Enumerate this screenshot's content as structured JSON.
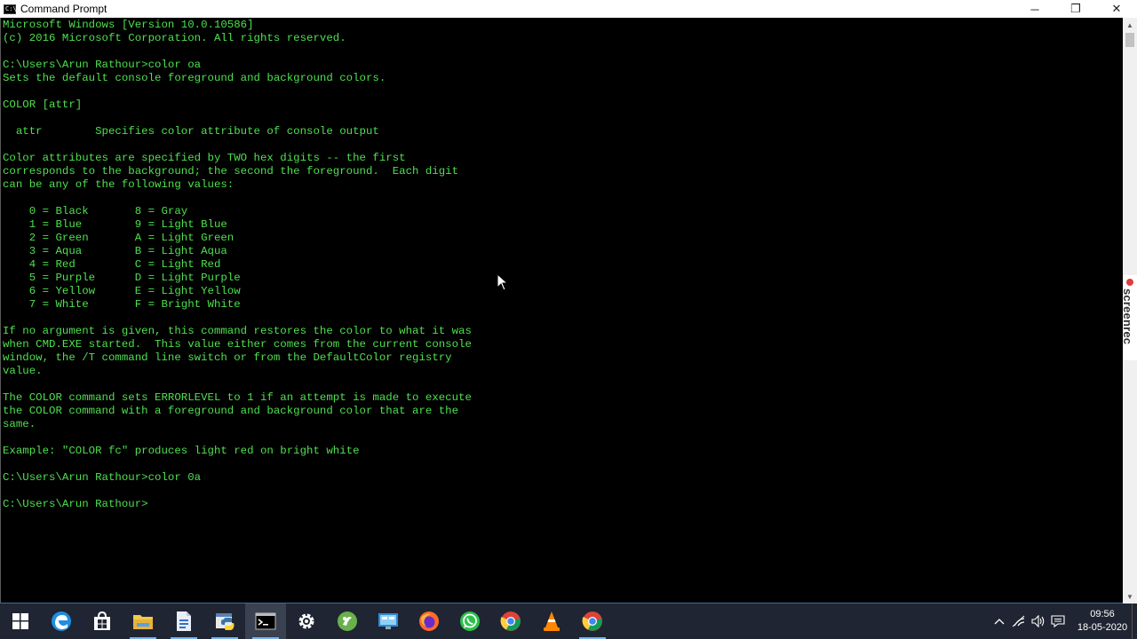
{
  "window": {
    "title": "Command Prompt",
    "icon_label": "C:\\",
    "controls": [
      "minimize-icon",
      "restore-icon",
      "close-icon"
    ]
  },
  "console": {
    "text_color": "#4ee04e",
    "background": "#000000",
    "lines": [
      "Microsoft Windows [Version 10.0.10586]",
      "(c) 2016 Microsoft Corporation. All rights reserved.",
      "",
      "C:\\Users\\Arun Rathour>color oa",
      "Sets the default console foreground and background colors.",
      "",
      "COLOR [attr]",
      "",
      "  attr        Specifies color attribute of console output",
      "",
      "Color attributes are specified by TWO hex digits -- the first",
      "corresponds to the background; the second the foreground.  Each digit",
      "can be any of the following values:",
      "",
      "    0 = Black       8 = Gray",
      "    1 = Blue        9 = Light Blue",
      "    2 = Green       A = Light Green",
      "    3 = Aqua        B = Light Aqua",
      "    4 = Red         C = Light Red",
      "    5 = Purple      D = Light Purple",
      "    6 = Yellow      E = Light Yellow",
      "    7 = White       F = Bright White",
      "",
      "If no argument is given, this command restores the color to what it was",
      "when CMD.EXE started.  This value either comes from the current console",
      "window, the /T command line switch or from the DefaultColor registry",
      "value.",
      "",
      "The COLOR command sets ERRORLEVEL to 1 if an attempt is made to execute",
      "the COLOR command with a foreground and background color that are the",
      "same.",
      "",
      "Example: \"COLOR fc\" produces light red on bright white",
      "",
      "C:\\Users\\Arun Rathour>color 0a",
      "",
      "C:\\Users\\Arun Rathour>"
    ]
  },
  "screenrec": {
    "label": "screenrec"
  },
  "taskbar": {
    "background": "#1f2532",
    "items": [
      {
        "icon": "start-windows-icon"
      },
      {
        "icon": "edge-browser-icon"
      },
      {
        "icon": "store-icon"
      },
      {
        "icon": "file-explorer-icon"
      },
      {
        "icon": "document-app-icon"
      },
      {
        "icon": "python-idle-icon"
      },
      {
        "icon": "command-prompt-icon",
        "active": true
      },
      {
        "icon": "settings-gear-icon"
      },
      {
        "icon": "green-app-icon"
      },
      {
        "icon": "computer-app-icon"
      },
      {
        "icon": "firefox-icon"
      },
      {
        "icon": "whatsapp-icon"
      },
      {
        "icon": "chrome-icon"
      },
      {
        "icon": "vlc-icon"
      },
      {
        "icon": "chrome-profile-icon"
      }
    ],
    "tray": {
      "icons": [
        "chevron-up-icon",
        "wifi-icon",
        "volume-icon",
        "notification-icon"
      ],
      "time": "09:56",
      "date": "18-05-2020"
    }
  }
}
